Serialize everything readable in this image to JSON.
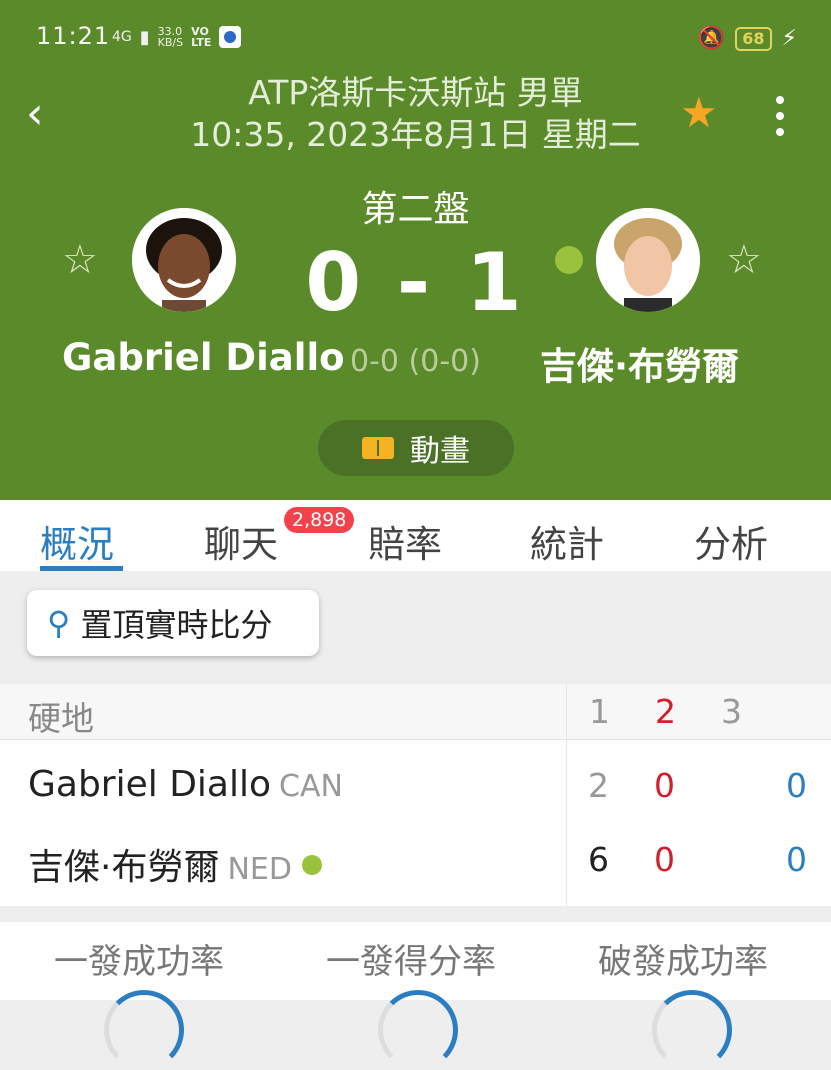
{
  "status_bar": {
    "time": "11:21",
    "network": "4G",
    "speed_top": "33.0",
    "speed_unit": "KB/S",
    "volte_top": "VO",
    "volte_bottom": "LTE",
    "battery": "68"
  },
  "header": {
    "tournament": "ATP洛斯卡沃斯站 男單",
    "datetime": "10:35, 2023年8月1日 星期二",
    "set_label": "第二盤",
    "score": "0 - 1",
    "sub_score": "0-0 (0-0)",
    "animation_label": "動畫"
  },
  "players": {
    "home": {
      "name": "Gabriel Diallo"
    },
    "away": {
      "name": "吉傑·布勞爾"
    }
  },
  "tabs": [
    {
      "label": "概況"
    },
    {
      "label": "聊天"
    },
    {
      "label": "賠率"
    },
    {
      "label": "統計"
    },
    {
      "label": "分析"
    }
  ],
  "chat_badge": "2,898",
  "pin_button": "置頂實時比分",
  "scorecard": {
    "surface": "硬地",
    "set_headers": [
      "1",
      "2",
      "3"
    ],
    "rows": [
      {
        "name": "Gabriel Diallo",
        "country": "CAN",
        "sets": [
          "2",
          "0"
        ],
        "total": "0"
      },
      {
        "name": "吉傑·布勞爾",
        "country": "NED",
        "sets": [
          "6",
          "0"
        ],
        "total": "0"
      }
    ]
  },
  "stats": [
    "一發成功率",
    "一發得分率",
    "破發成功率"
  ],
  "colors": {
    "header_bg": "#5b8a2a",
    "accent": "#2a7ec1",
    "live_red": "#d0202c",
    "star": "#f5a623",
    "badge": "#f4424b"
  }
}
